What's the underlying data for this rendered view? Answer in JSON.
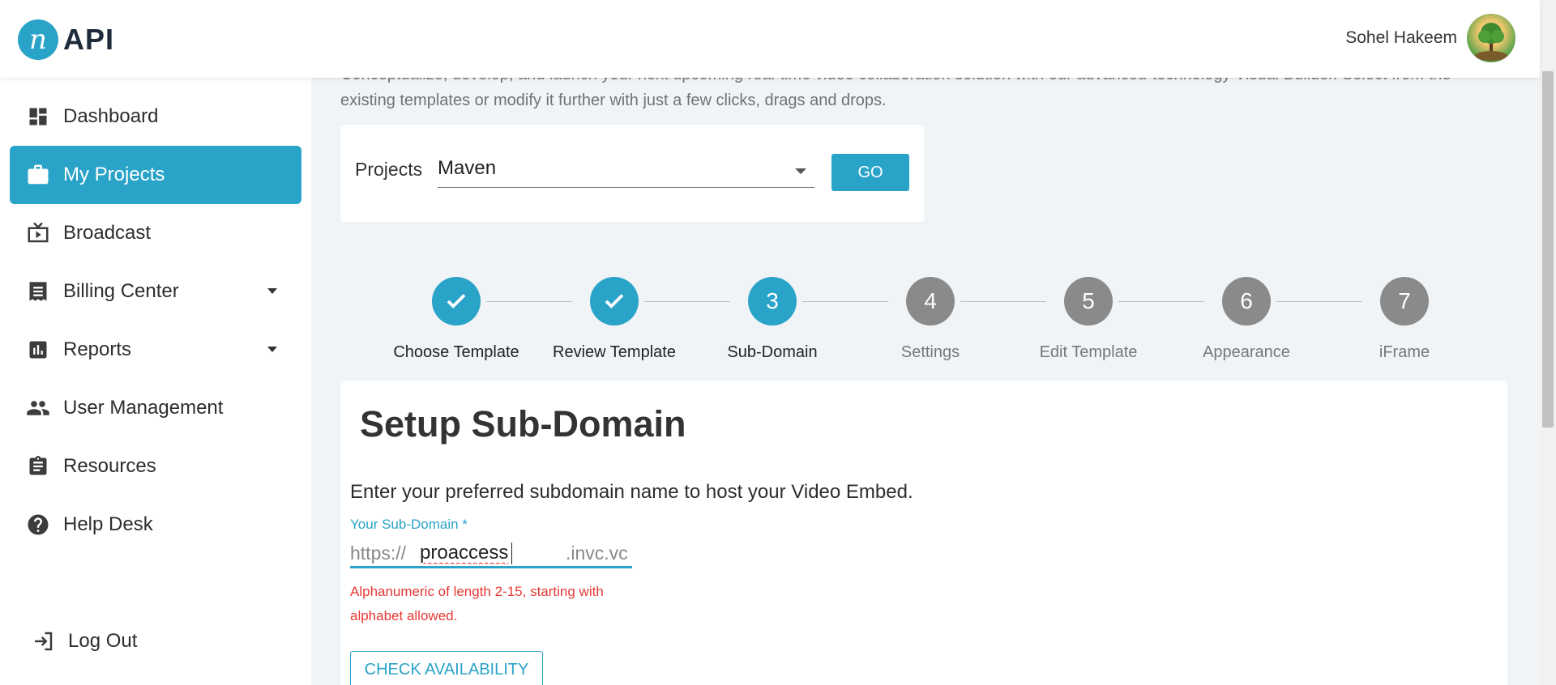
{
  "header": {
    "logo_mark": "n",
    "logo_text": "API",
    "user_name": "Sohel Hakeem"
  },
  "sidebar": {
    "items": [
      {
        "label": "Dashboard",
        "icon": "dashboard-icon"
      },
      {
        "label": "My Projects",
        "icon": "briefcase-icon",
        "active": true
      },
      {
        "label": "Broadcast",
        "icon": "tv-icon"
      },
      {
        "label": "Billing Center",
        "icon": "receipt-icon",
        "has_dropdown": true
      },
      {
        "label": "Reports",
        "icon": "bar-chart-icon",
        "has_dropdown": true
      },
      {
        "label": "User Management",
        "icon": "people-icon"
      },
      {
        "label": "Resources",
        "icon": "clipboard-icon"
      },
      {
        "label": "Help Desk",
        "icon": "help-icon"
      }
    ],
    "logout_label": "Log Out"
  },
  "main": {
    "intro": "Conceptualize, develop, and launch your next upcoming real-time video collaboration solution with our advanced-technology Visual Builder. Select from the existing templates or modify it further with just a few clicks, drags and drops.",
    "projects": {
      "label": "Projects",
      "selected": "Maven",
      "go_label": "GO"
    },
    "stepper": [
      {
        "number": "1",
        "label": "Choose Template",
        "status": "done"
      },
      {
        "number": "2",
        "label": "Review Template",
        "status": "done"
      },
      {
        "number": "3",
        "label": "Sub-Domain",
        "status": "current"
      },
      {
        "number": "4",
        "label": "Settings",
        "status": "pending"
      },
      {
        "number": "5",
        "label": "Edit Template",
        "status": "pending"
      },
      {
        "number": "6",
        "label": "Appearance",
        "status": "pending"
      },
      {
        "number": "7",
        "label": "iFrame",
        "status": "pending"
      }
    ],
    "setup": {
      "title": "Setup Sub-Domain",
      "description": "Enter your preferred subdomain name to host your Video Embed.",
      "field_label": "Your Sub-Domain *",
      "prefix": "https://",
      "value": "proaccess",
      "suffix": ".invc.vc",
      "error": "Alphanumeric of length 2-15, starting with alphabet allowed.",
      "check_label": "CHECK AVAILABILITY"
    }
  },
  "colors": {
    "accent": "#2aa3c9",
    "pending": "#8a8a8a",
    "error": "#e53935"
  }
}
